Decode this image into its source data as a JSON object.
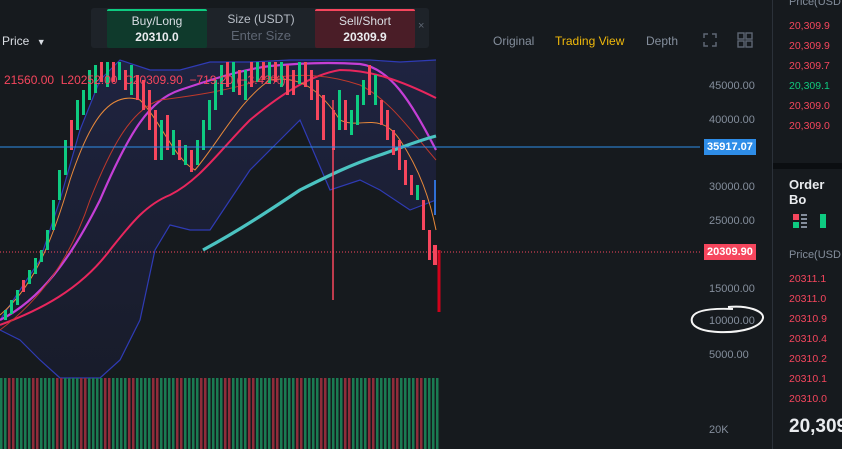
{
  "toolbar": {
    "price_dropdown": "Price",
    "views": [
      "Original",
      "Trading View",
      "Depth"
    ],
    "active_view": "Trading View"
  },
  "trade_widget": {
    "buy_label": "Buy/Long",
    "buy_price": "20310.0",
    "size_label": "Size (USDT)",
    "size_placeholder": "Enter Size",
    "sell_label": "Sell/Short",
    "sell_price": "20309.9",
    "close_symbol": "×"
  },
  "ohlc": "21560.00  L20252.00  C20309.90  −719.20 (−3.42%)",
  "price_axis": {
    "ticks": [
      "45000.00",
      "40000.00",
      "35000.00",
      "30000.00",
      "25000.00",
      "20000.00",
      "15000.00",
      "10000.00",
      "5000.00"
    ],
    "vol_tick": "20K",
    "marker_blue": "35917.07",
    "marker_red": "20309.90"
  },
  "right_panel": {
    "header": "Price(USD",
    "top_prices": [
      "20,309.9",
      "20,309.9",
      "20,309.7",
      "20,309.1",
      "20,309.0",
      "20,309.0"
    ],
    "order_book_title": "Order Bo",
    "price_col": "Price(USD",
    "asks": [
      "20311.1",
      "20311.0",
      "20310.9",
      "20310.4",
      "20310.2",
      "20310.1",
      "20310.0"
    ],
    "last_price": "20,309"
  },
  "colors": {
    "up": "#0ecb81",
    "down": "#f6465d",
    "accent": "#f0b90b",
    "bg": "#161a1e"
  }
}
